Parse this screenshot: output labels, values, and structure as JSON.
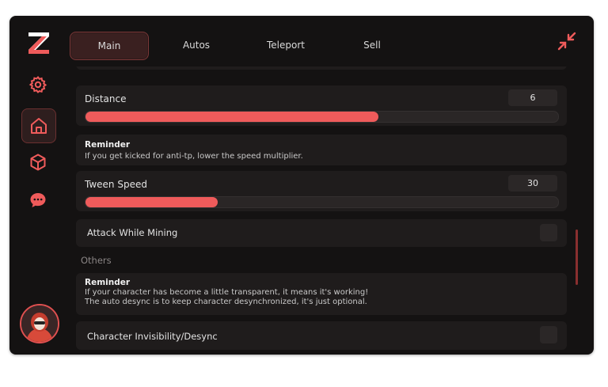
{
  "brand": {
    "logo_letter": "Z",
    "accent": "#ef5b5b"
  },
  "tabs": [
    {
      "label": "Main",
      "active": true
    },
    {
      "label": "Autos",
      "active": false
    },
    {
      "label": "Teleport",
      "active": false
    },
    {
      "label": "Sell",
      "active": false
    }
  ],
  "sidebar": [
    {
      "icon": "gear-icon",
      "active": false
    },
    {
      "icon": "home-icon",
      "active": true
    },
    {
      "icon": "cube-icon",
      "active": false
    },
    {
      "icon": "chat-icon",
      "active": false
    }
  ],
  "main": {
    "distance": {
      "label": "Distance",
      "value": "6",
      "fill_fraction": 0.62
    },
    "reminder1": {
      "title": "Reminder",
      "text": "If you get kicked for anti-tp, lower the speed multiplier."
    },
    "tween": {
      "label": "Tween Speed",
      "value": "30",
      "fill_fraction": 0.28
    },
    "attack": {
      "label": "Attack While Mining",
      "enabled": false
    },
    "others_header": "Others",
    "reminder2": {
      "title": "Reminder",
      "line1": "If your character has become a little transparent, it means it's working!",
      "line2": "The auto desync is to keep character desynchronized, it's just optional."
    },
    "invis": {
      "label": "Character Invisibility/Desync",
      "enabled": false
    }
  }
}
